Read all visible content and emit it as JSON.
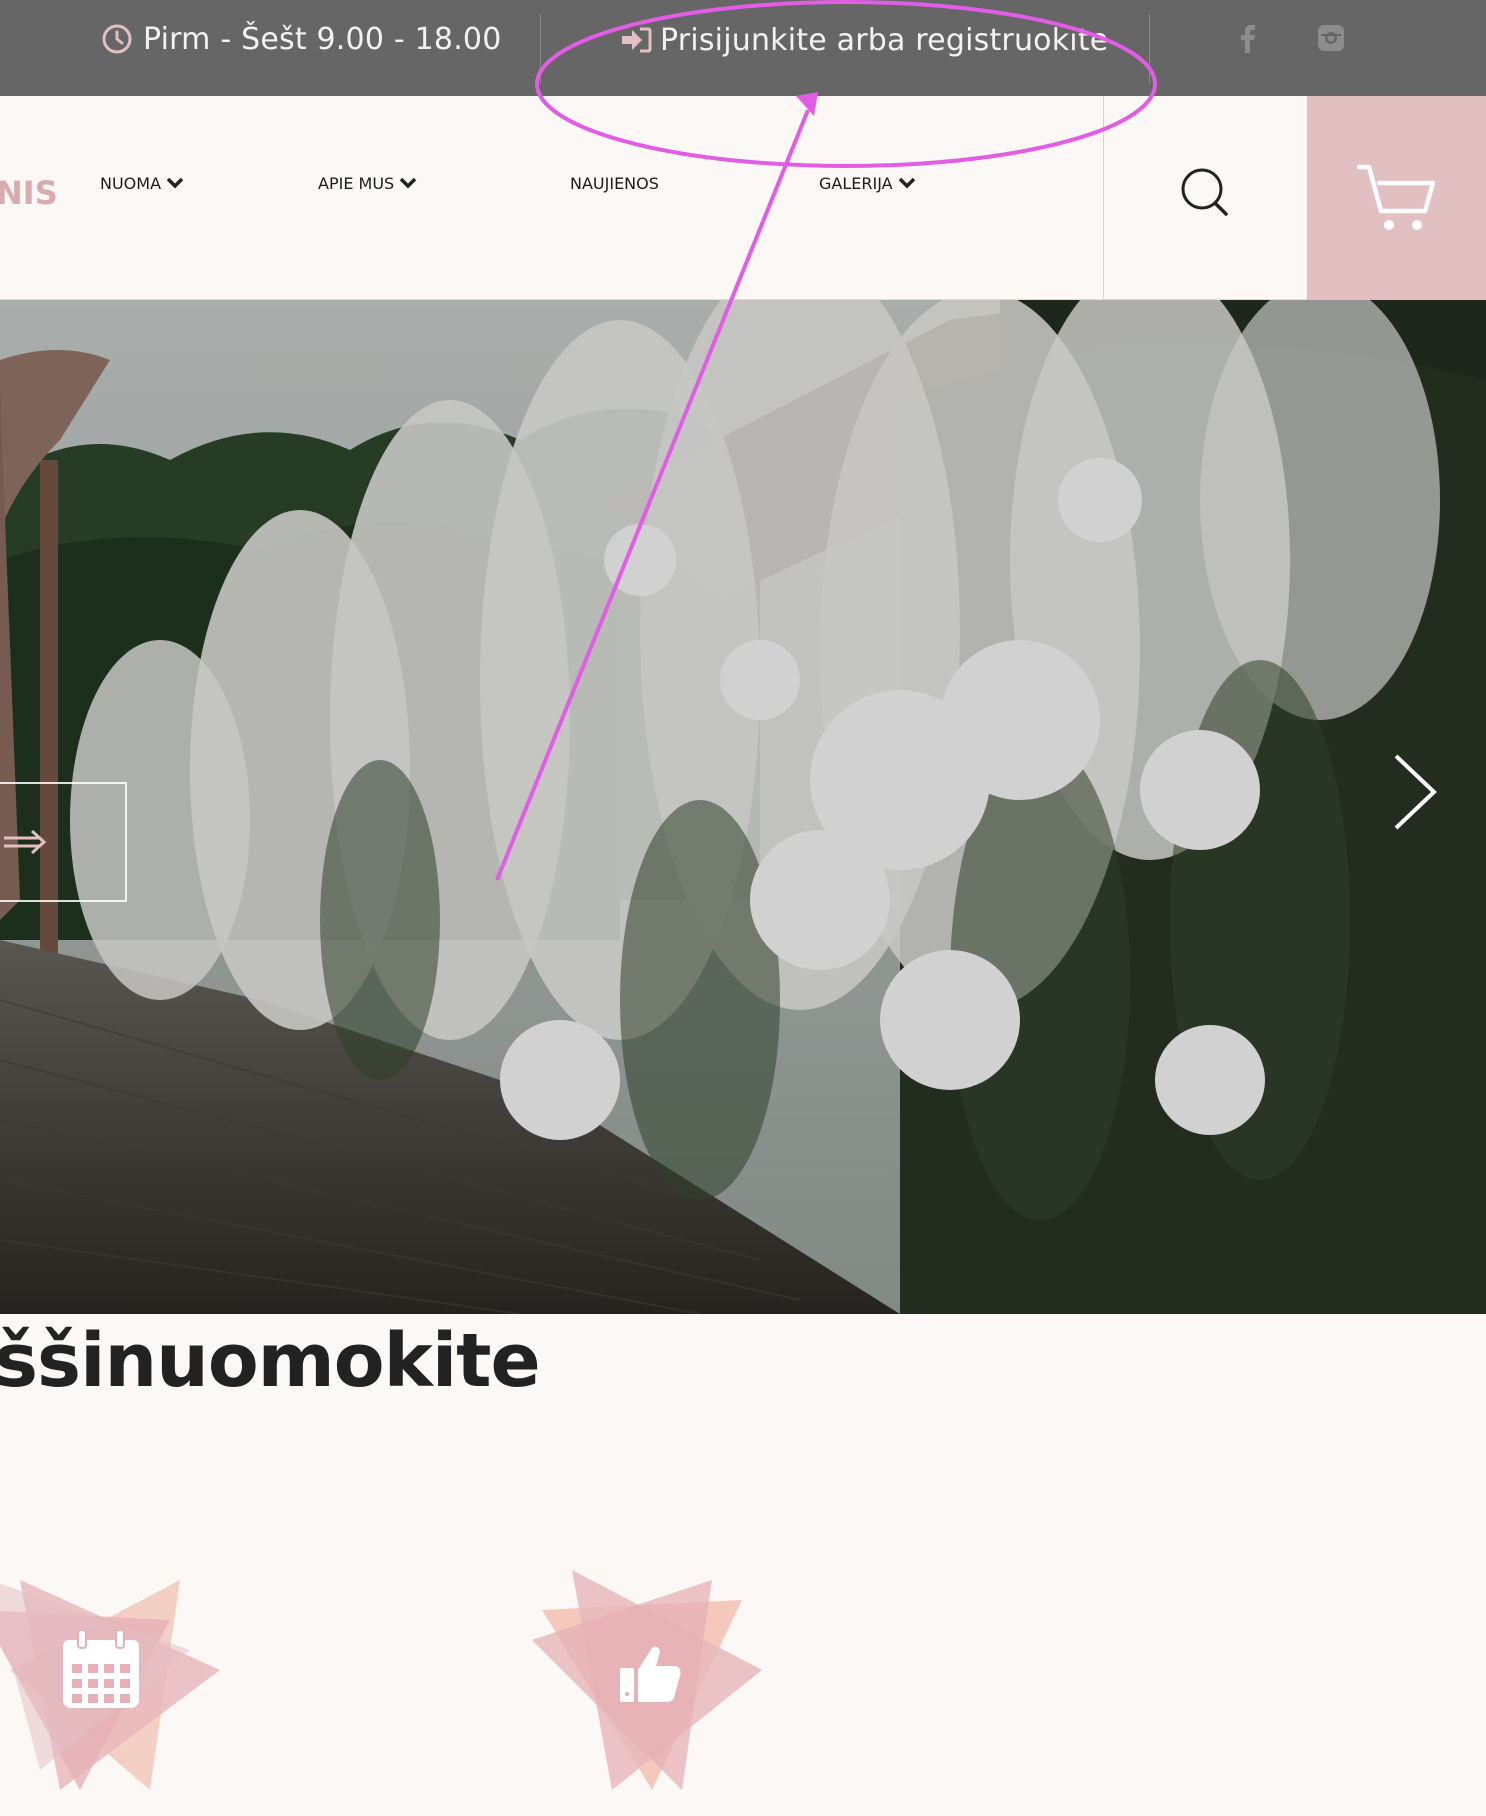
{
  "topbar": {
    "hours_text": "Pirm - Šešt 9.00 - 18.00",
    "login_text": "Prisijunkite arba registruokite",
    "clock_icon": "clock-icon",
    "login_icon": "sign-in-icon",
    "social": [
      "facebook-icon",
      "instagram-icon"
    ]
  },
  "nav": {
    "partial_item": "NIS",
    "items": [
      {
        "label": "NUOMA",
        "has_dropdown": true
      },
      {
        "label": "APIE MUS",
        "has_dropdown": true
      },
      {
        "label": "NAUJIENOS",
        "has_dropdown": false
      },
      {
        "label": "GALERIJA",
        "has_dropdown": true
      }
    ],
    "search_icon": "search-icon",
    "cart_icon": "cart-icon"
  },
  "hero": {
    "prev_icon": "arrow-right-icon",
    "next_icon": "chevron-right-icon"
  },
  "section": {
    "heading": "ššinuomokite"
  },
  "features": [
    {
      "icon": "calendar-icon"
    },
    {
      "icon": "thumbs-up-icon"
    }
  ],
  "colors": {
    "topbar_bg": "#666666",
    "page_bg": "#fbf8f5",
    "accent_pink": "#e2bfc1",
    "active_nav": "#d9aab0",
    "annotation": "#e25ce6"
  }
}
